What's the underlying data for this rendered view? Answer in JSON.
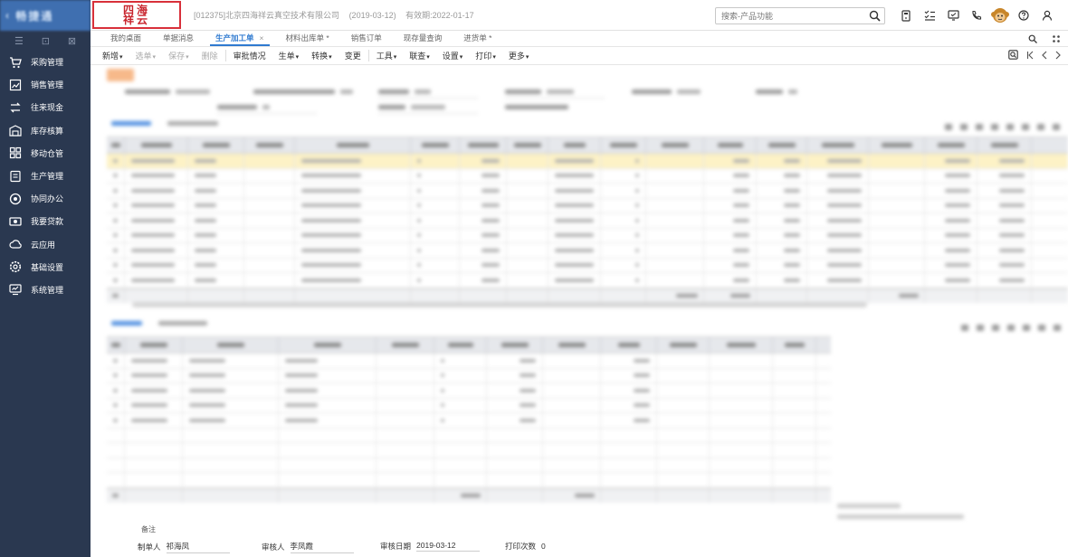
{
  "sidebar": {
    "logo_text": "畅捷通",
    "tools": [
      "menu-icon",
      "collapse-icon",
      "edit-icon"
    ],
    "items": [
      {
        "label": "采购管理",
        "icon": "cart-icon"
      },
      {
        "label": "销售管理",
        "icon": "chart-icon"
      },
      {
        "label": "往来现金",
        "icon": "exchange-icon"
      },
      {
        "label": "库存核算",
        "icon": "warehouse-icon"
      },
      {
        "label": "移动仓管",
        "icon": "grid-icon"
      },
      {
        "label": "生产管理",
        "icon": "production-icon"
      },
      {
        "label": "协同办公",
        "icon": "collaboration-icon"
      },
      {
        "label": "我要贷款",
        "icon": "money-icon"
      },
      {
        "label": "云应用",
        "icon": "cloud-icon"
      },
      {
        "label": "基础设置",
        "icon": "settings-icon"
      },
      {
        "label": "系统管理",
        "icon": "monitor-icon"
      }
    ]
  },
  "header": {
    "brand_line1": "四海",
    "brand_line2": "祥云",
    "company": "[012375]北京四海祥云真空技术有限公司",
    "date": "(2019-03-12)",
    "expiry": "有效期:2022-01-17",
    "search_placeholder": "搜索-产品功能"
  },
  "tabs": [
    {
      "label": "我的桌面",
      "active": false,
      "closable": false
    },
    {
      "label": "单据消息",
      "active": false,
      "closable": false
    },
    {
      "label": "生产加工单",
      "active": true,
      "closable": true
    },
    {
      "label": "材料出库单 *",
      "active": false,
      "closable": false
    },
    {
      "label": "销售订单",
      "active": false,
      "closable": false
    },
    {
      "label": "现存量查询",
      "active": false,
      "closable": false
    },
    {
      "label": "进货单 *",
      "active": false,
      "closable": false
    }
  ],
  "toolbar": [
    {
      "label": "新增",
      "dropdown": true,
      "disabled": false
    },
    {
      "label": "选单",
      "dropdown": true,
      "disabled": true
    },
    {
      "label": "保存",
      "dropdown": true,
      "disabled": true
    },
    {
      "label": "删除",
      "dropdown": false,
      "disabled": true
    },
    {
      "label": "审批情况",
      "dropdown": false,
      "disabled": false
    },
    {
      "label": "生单",
      "dropdown": true,
      "disabled": false
    },
    {
      "label": "转换",
      "dropdown": true,
      "disabled": false
    },
    {
      "label": "变更",
      "dropdown": false,
      "disabled": false
    },
    {
      "label": "工具",
      "dropdown": true,
      "disabled": false
    },
    {
      "label": "联查",
      "dropdown": true,
      "disabled": false
    },
    {
      "label": "设置",
      "dropdown": true,
      "disabled": false
    },
    {
      "label": "打印",
      "dropdown": true,
      "disabled": false
    },
    {
      "label": "更多",
      "dropdown": true,
      "disabled": false
    }
  ],
  "footer": {
    "remark_label": "备注",
    "maker_label": "制单人",
    "maker": "祁海凤",
    "auditor_label": "审核人",
    "auditor": "李凤霞",
    "audit_date_label": "审核日期",
    "audit_date": "2019-03-12",
    "print_count_label": "打印次数",
    "print_count": "0"
  },
  "colors": {
    "sidebar_bg": "#2a3850",
    "logo_bg": "#3f6fb0",
    "accent": "#2f7ad0",
    "brand_red": "#d8303a",
    "selected_row": "#fdf2c6"
  }
}
